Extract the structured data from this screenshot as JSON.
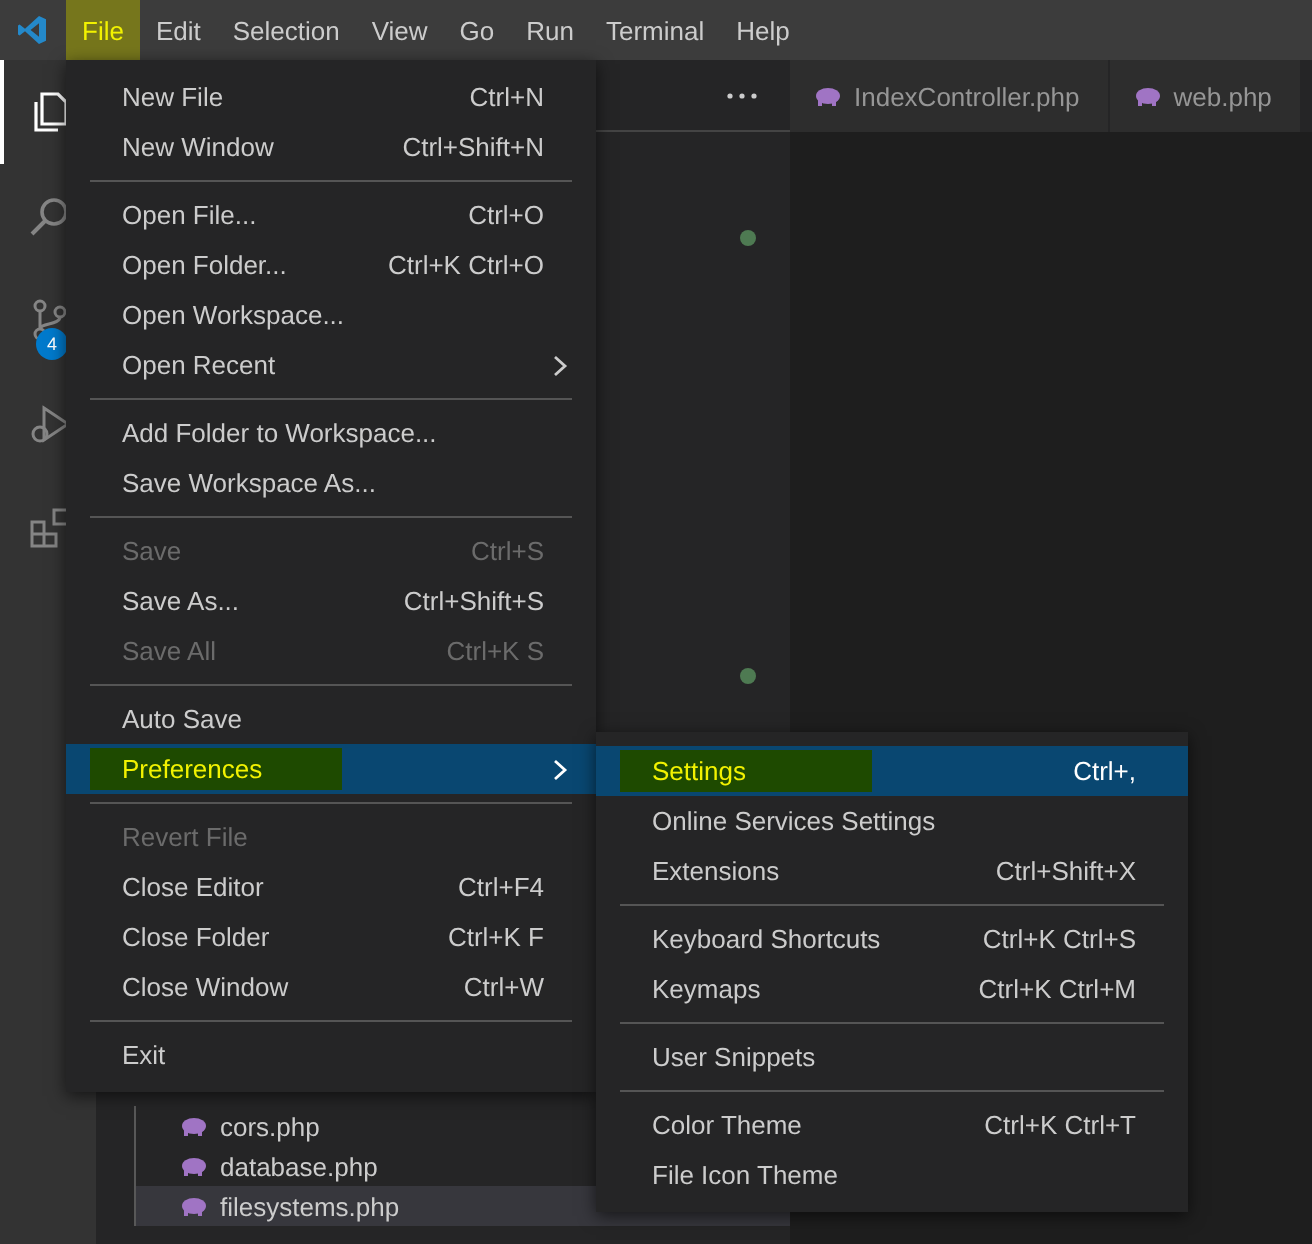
{
  "menubar": [
    {
      "label": "File",
      "open": true,
      "marked": true
    },
    {
      "label": "Edit",
      "open": false,
      "marked": false
    },
    {
      "label": "Selection",
      "open": false,
      "marked": false
    },
    {
      "label": "View",
      "open": false,
      "marked": false
    },
    {
      "label": "Go",
      "open": false,
      "marked": false
    },
    {
      "label": "Run",
      "open": false,
      "marked": false
    },
    {
      "label": "Terminal",
      "open": false,
      "marked": false
    },
    {
      "label": "Help",
      "open": false,
      "marked": false
    }
  ],
  "activity_bar": [
    {
      "kind": "explorer",
      "selected": true
    },
    {
      "kind": "search",
      "selected": false
    },
    {
      "kind": "source-control",
      "selected": false,
      "badge": "4"
    },
    {
      "kind": "run",
      "selected": false
    },
    {
      "kind": "extensions",
      "selected": false
    }
  ],
  "files": [
    {
      "name": "cors.php",
      "selected": false
    },
    {
      "name": "database.php",
      "selected": false
    },
    {
      "name": "filesystems.php",
      "selected": true
    }
  ],
  "editor_tabs": [
    {
      "label": "IndexController.php",
      "selected": false
    },
    {
      "label": "web.php",
      "selected": false
    }
  ],
  "file_menu": {
    "items": [
      {
        "kind": "item",
        "label": "New File",
        "shortcut": "Ctrl+N",
        "disabled": false,
        "selected": false,
        "marked": false,
        "submenu": false
      },
      {
        "kind": "item",
        "label": "New Window",
        "shortcut": "Ctrl+Shift+N",
        "disabled": false,
        "selected": false,
        "marked": false,
        "submenu": false
      },
      {
        "kind": "separator"
      },
      {
        "kind": "item",
        "label": "Open File...",
        "shortcut": "Ctrl+O",
        "disabled": false,
        "selected": false,
        "marked": false,
        "submenu": false
      },
      {
        "kind": "item",
        "label": "Open Folder...",
        "shortcut": "Ctrl+K Ctrl+O",
        "disabled": false,
        "selected": false,
        "marked": false,
        "submenu": false
      },
      {
        "kind": "item",
        "label": "Open Workspace...",
        "disabled": false,
        "selected": false,
        "marked": false,
        "submenu": false
      },
      {
        "kind": "item",
        "label": "Open Recent",
        "disabled": false,
        "selected": false,
        "marked": false,
        "submenu": true
      },
      {
        "kind": "separator"
      },
      {
        "kind": "item",
        "label": "Add Folder to Workspace...",
        "disabled": false,
        "selected": false,
        "marked": false,
        "submenu": false
      },
      {
        "kind": "item",
        "label": "Save Workspace As...",
        "disabled": false,
        "selected": false,
        "marked": false,
        "submenu": false
      },
      {
        "kind": "separator"
      },
      {
        "kind": "item",
        "label": "Save",
        "shortcut": "Ctrl+S",
        "disabled": true,
        "selected": false,
        "marked": false,
        "submenu": false
      },
      {
        "kind": "item",
        "label": "Save As...",
        "shortcut": "Ctrl+Shift+S",
        "disabled": false,
        "selected": false,
        "marked": false,
        "submenu": false
      },
      {
        "kind": "item",
        "label": "Save All",
        "shortcut": "Ctrl+K S",
        "disabled": true,
        "selected": false,
        "marked": false,
        "submenu": false
      },
      {
        "kind": "separator"
      },
      {
        "kind": "item",
        "label": "Auto Save",
        "disabled": false,
        "selected": false,
        "marked": false,
        "submenu": false
      },
      {
        "kind": "item",
        "label": "Preferences",
        "disabled": false,
        "selected": true,
        "marked": true,
        "submenu": true
      },
      {
        "kind": "separator"
      },
      {
        "kind": "item",
        "label": "Revert File",
        "disabled": true,
        "selected": false,
        "marked": false,
        "submenu": false
      },
      {
        "kind": "item",
        "label": "Close Editor",
        "shortcut": "Ctrl+F4",
        "disabled": false,
        "selected": false,
        "marked": false,
        "submenu": false
      },
      {
        "kind": "item",
        "label": "Close Folder",
        "shortcut": "Ctrl+K F",
        "disabled": false,
        "selected": false,
        "marked": false,
        "submenu": false
      },
      {
        "kind": "item",
        "label": "Close Window",
        "shortcut": "Ctrl+W",
        "disabled": false,
        "selected": false,
        "marked": false,
        "submenu": false
      },
      {
        "kind": "separator"
      },
      {
        "kind": "item",
        "label": "Exit",
        "disabled": false,
        "selected": false,
        "marked": false,
        "submenu": false
      }
    ]
  },
  "preferences_menu": {
    "items": [
      {
        "kind": "item",
        "label": "Settings",
        "shortcut": "Ctrl+,",
        "disabled": false,
        "selected": true,
        "marked": true,
        "submenu": false
      },
      {
        "kind": "item",
        "label": "Online Services Settings",
        "disabled": false,
        "selected": false,
        "marked": false,
        "submenu": false
      },
      {
        "kind": "item",
        "label": "Extensions",
        "shortcut": "Ctrl+Shift+X",
        "disabled": false,
        "selected": false,
        "marked": false,
        "submenu": false
      },
      {
        "kind": "separator"
      },
      {
        "kind": "item",
        "label": "Keyboard Shortcuts",
        "shortcut": "Ctrl+K Ctrl+S",
        "disabled": false,
        "selected": false,
        "marked": false,
        "submenu": false
      },
      {
        "kind": "item",
        "label": "Keymaps",
        "shortcut": "Ctrl+K Ctrl+M",
        "disabled": false,
        "selected": false,
        "marked": false,
        "submenu": false
      },
      {
        "kind": "separator"
      },
      {
        "kind": "item",
        "label": "User Snippets",
        "disabled": false,
        "selected": false,
        "marked": false,
        "submenu": false
      },
      {
        "kind": "separator"
      },
      {
        "kind": "item",
        "label": "Color Theme",
        "shortcut": "Ctrl+K Ctrl+T",
        "disabled": false,
        "selected": false,
        "marked": false,
        "submenu": false
      },
      {
        "kind": "item",
        "label": "File Icon Theme",
        "disabled": false,
        "selected": false,
        "marked": false,
        "submenu": false
      }
    ]
  }
}
